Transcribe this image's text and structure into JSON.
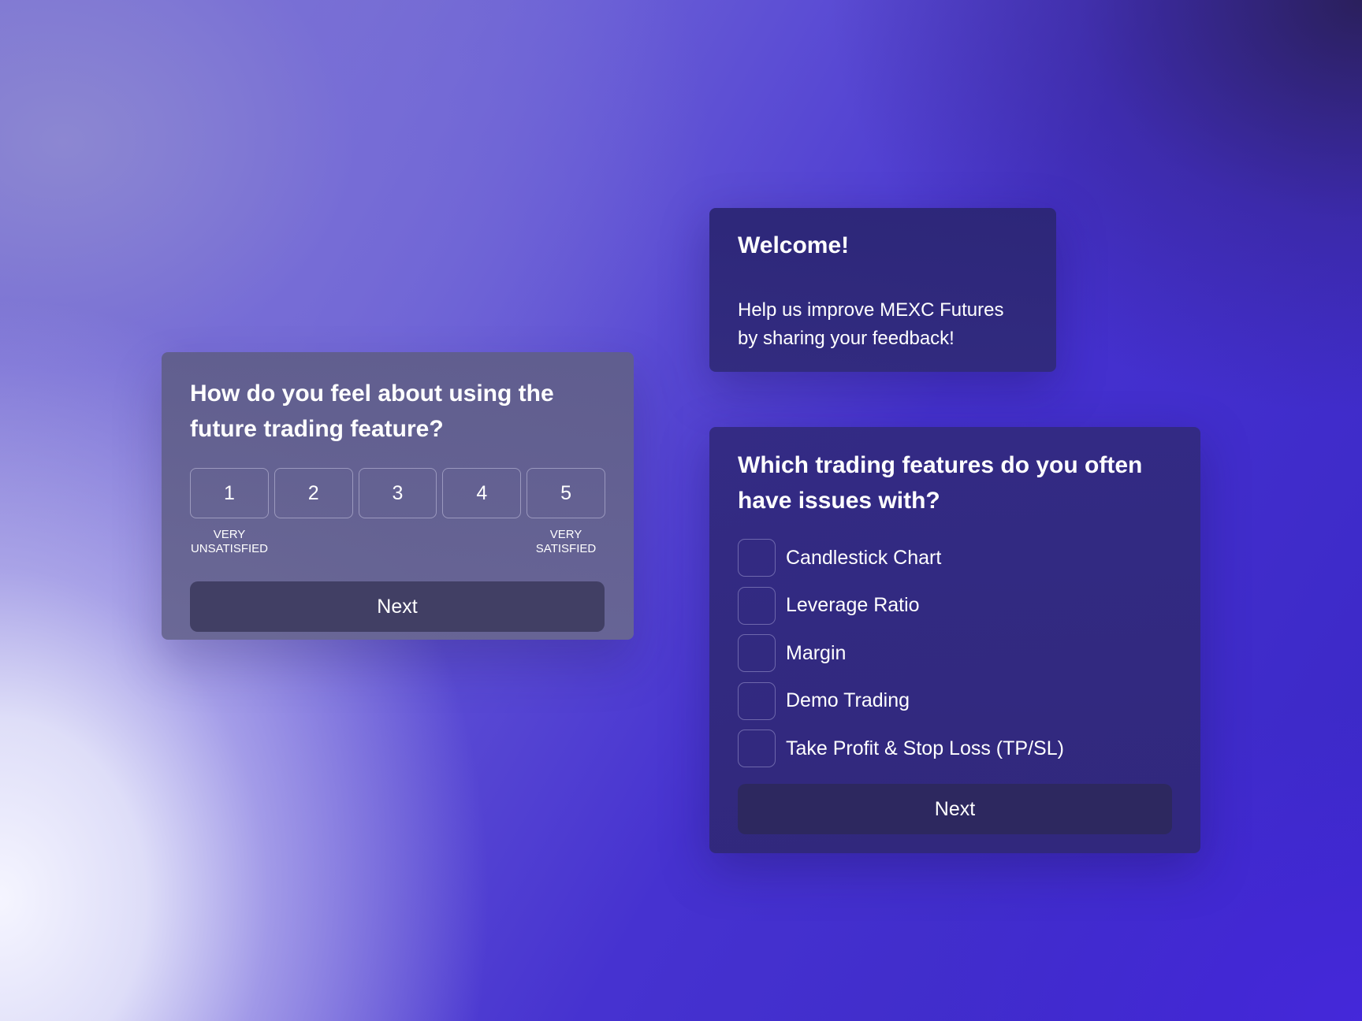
{
  "rating_card": {
    "question": "How do you feel about using the future trading feature?",
    "options": [
      "1",
      "2",
      "3",
      "4",
      "5"
    ],
    "low_label": "VERY UNSATISFIED",
    "low_label_line1": "VERY",
    "low_label_line2": "UNSATISFIED",
    "high_label_line1": "VERY",
    "high_label_line2": "SATISFIED",
    "next_label": "Next"
  },
  "welcome_card": {
    "title": "Welcome!",
    "body_line1": "Help us improve MEXC Futures",
    "body_line2": "by sharing your feedback!"
  },
  "issues_card": {
    "question": "Which trading features do you often have issues with?",
    "options": [
      {
        "label": "Candlestick Chart",
        "checked": false
      },
      {
        "label": "Leverage Ratio",
        "checked": false
      },
      {
        "label": "Margin",
        "checked": false
      },
      {
        "label": "Demo Trading",
        "checked": false
      },
      {
        "label": "Take Profit & Stop Loss (TP/SL)",
        "checked": false
      }
    ],
    "next_label": "Next"
  },
  "colors": {
    "accent_background": "#3a27c6",
    "text": "#ffffff"
  }
}
